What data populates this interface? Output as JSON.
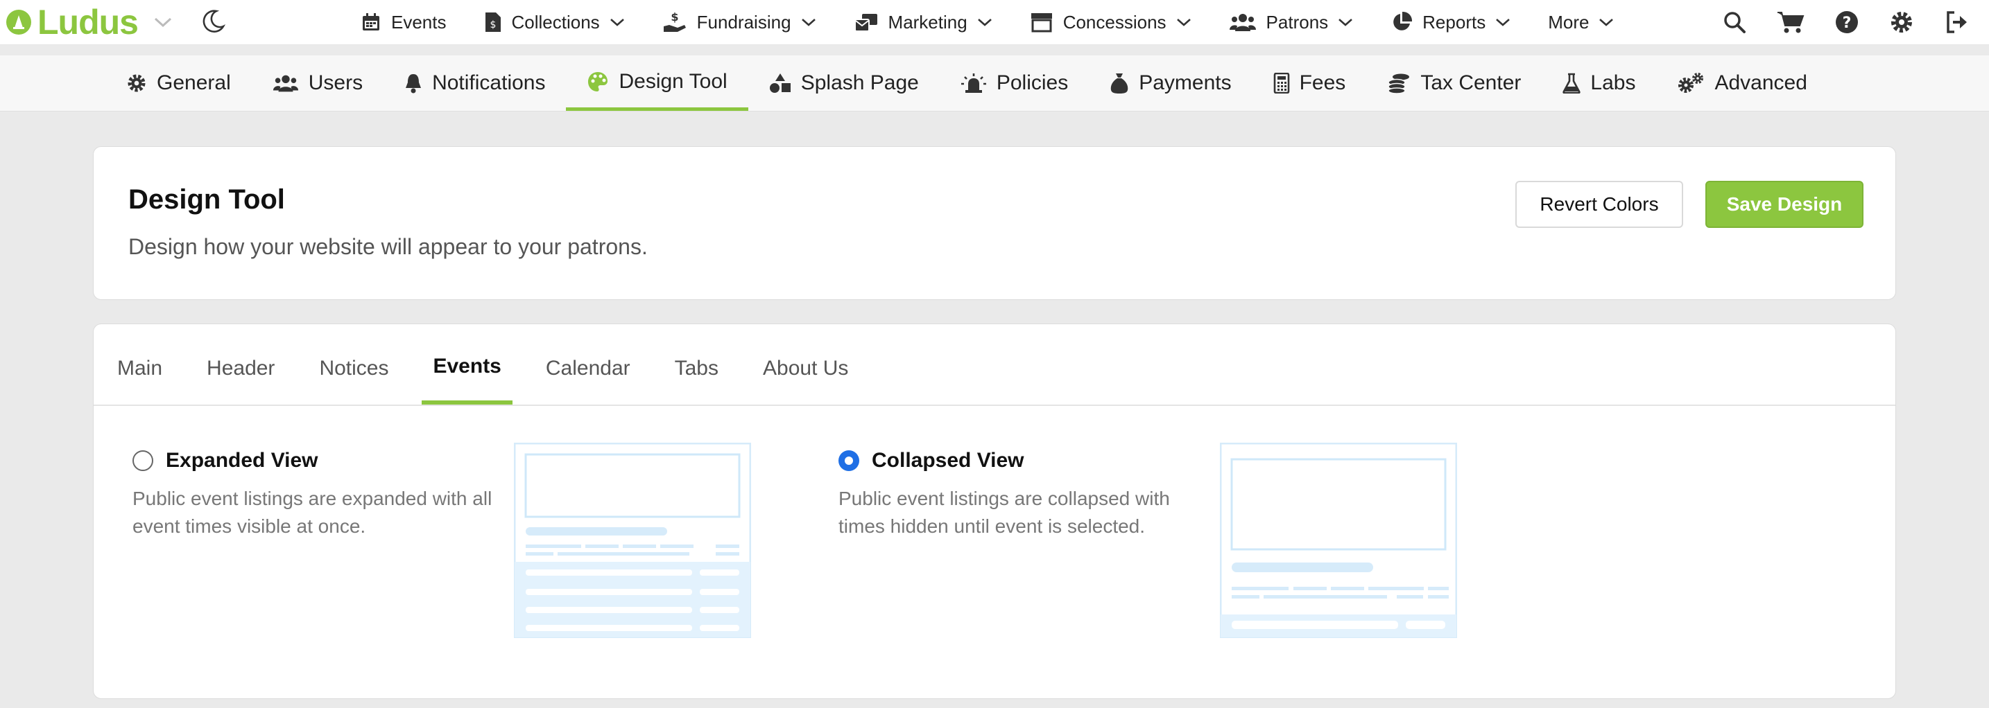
{
  "app": {
    "brand": "Ludus"
  },
  "top_nav": [
    {
      "label": "Events",
      "icon": "calendar-icon",
      "has_dropdown": false
    },
    {
      "label": "Collections",
      "icon": "donation-file-icon",
      "has_dropdown": true
    },
    {
      "label": "Fundraising",
      "icon": "hand-money-icon",
      "has_dropdown": true
    },
    {
      "label": "Marketing",
      "icon": "mail-bulk-icon",
      "has_dropdown": true
    },
    {
      "label": "Concessions",
      "icon": "store-icon",
      "has_dropdown": true
    },
    {
      "label": "Patrons",
      "icon": "users-icon",
      "has_dropdown": true
    },
    {
      "label": "Reports",
      "icon": "pie-chart-icon",
      "has_dropdown": true
    },
    {
      "label": "More",
      "icon": "",
      "has_dropdown": true
    }
  ],
  "top_icons": [
    "search-icon",
    "cart-icon",
    "help-icon",
    "gear-icon",
    "sign-out-icon"
  ],
  "settings_tabs": [
    {
      "label": "General",
      "icon": "gear-icon",
      "active": false
    },
    {
      "label": "Users",
      "icon": "users-icon",
      "active": false
    },
    {
      "label": "Notifications",
      "icon": "bell-icon",
      "active": false
    },
    {
      "label": "Design Tool",
      "icon": "palette-icon",
      "active": true
    },
    {
      "label": "Splash Page",
      "icon": "shapes-icon",
      "active": false
    },
    {
      "label": "Policies",
      "icon": "siren-icon",
      "active": false
    },
    {
      "label": "Payments",
      "icon": "money-bag-icon",
      "active": false
    },
    {
      "label": "Fees",
      "icon": "calculator-icon",
      "active": false
    },
    {
      "label": "Tax Center",
      "icon": "coins-icon",
      "active": false
    },
    {
      "label": "Labs",
      "icon": "flask-icon",
      "active": false
    },
    {
      "label": "Advanced",
      "icon": "gears-icon",
      "active": false
    }
  ],
  "header": {
    "title": "Design Tool",
    "subtitle": "Design how your website will appear to your patrons.",
    "revert_label": "Revert Colors",
    "save_label": "Save Design"
  },
  "design_tabs": [
    {
      "label": "Main",
      "active": false
    },
    {
      "label": "Header",
      "active": false
    },
    {
      "label": "Notices",
      "active": false
    },
    {
      "label": "Events",
      "active": true
    },
    {
      "label": "Calendar",
      "active": false
    },
    {
      "label": "Tabs",
      "active": false
    },
    {
      "label": "About Us",
      "active": false
    }
  ],
  "events_view": {
    "options": [
      {
        "title": "Expanded View",
        "description": "Public event listings are expanded with all event times visible at once.",
        "selected": false
      },
      {
        "title": "Collapsed View",
        "description": "Public event listings are collapsed with times hidden until event is selected.",
        "selected": true
      }
    ]
  },
  "colors": {
    "brand_green": "#8cc63f",
    "radio_blue": "#1f6fe5",
    "preview_light": "#e3f2fd",
    "preview_line": "#cfe8f9"
  }
}
